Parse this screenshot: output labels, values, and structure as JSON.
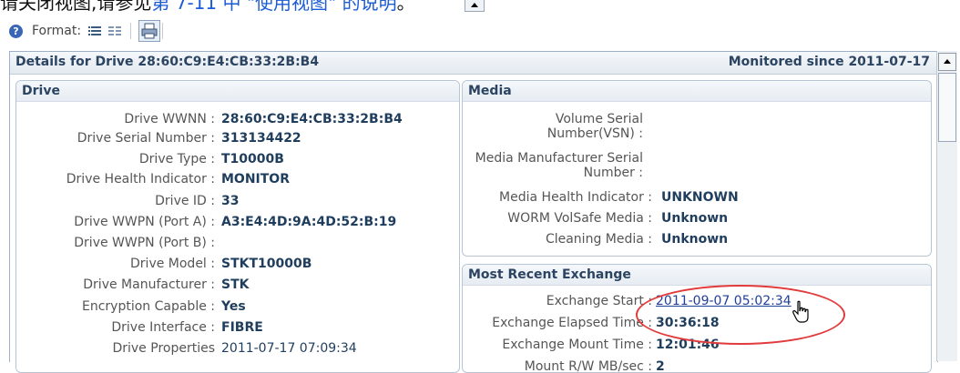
{
  "top_strip": {
    "text_prefix": "请关闭视图,请参见",
    "link_text": "第 7-11 中 \"使用视图\" 的说明",
    "text_suffix": "。"
  },
  "toolbar": {
    "help_icon": "?",
    "format_label": "Format:"
  },
  "panel": {
    "title": "Details for Drive 28:60:C9:E4:CB:33:2B:B4",
    "monitored": "Monitored since 2011-07-17"
  },
  "drive": {
    "header": "Drive",
    "rows": [
      {
        "label": "Drive WWNN :",
        "value": "28:60:C9:E4:CB:33:2B:B4"
      },
      {
        "label": "Drive Serial Number :",
        "value": "313134422"
      },
      {
        "label": "Drive Type :",
        "value": "T10000B"
      },
      {
        "label": "Drive Health Indicator :",
        "value": "MONITOR"
      },
      {
        "label": "Drive ID :",
        "value": "33"
      },
      {
        "label": "Drive WWPN (Port A) :",
        "value": "A3:E4:4D:9A:4D:52:B:19"
      },
      {
        "label": "Drive WWPN (Port B) :",
        "value": ""
      },
      {
        "label": "Drive Model :",
        "value": "STKT10000B"
      },
      {
        "label": "Drive Manufacturer :",
        "value": "STK"
      },
      {
        "label": "Encryption Capable :",
        "value": "Yes"
      },
      {
        "label": "Drive Interface :",
        "value": "FIBRE"
      },
      {
        "label": "Drive Properties",
        "value": "2011-07-17 07:09:34"
      }
    ]
  },
  "media": {
    "header": "Media",
    "rows": [
      {
        "label1": "Volume Serial",
        "label2": "Number(VSN) :",
        "value": ""
      },
      {
        "label1": "Media Manufacturer Serial",
        "label2": "Number :",
        "value": ""
      },
      {
        "label": "Media Health Indicator :",
        "value": "UNKNOWN"
      },
      {
        "label": "WORM VolSafe Media :",
        "value": "Unknown"
      },
      {
        "label": "Cleaning Media :",
        "value": "Unknown"
      }
    ]
  },
  "exchange": {
    "header": "Most Recent Exchange",
    "rows": [
      {
        "label": "Exchange Start :",
        "value": "2011-09-07 05:02:34"
      },
      {
        "label": "Exchange Elapsed Time :",
        "value": "30:36:18"
      },
      {
        "label": "Exchange Mount Time :",
        "value": "12:01:46"
      },
      {
        "label": "Mount R/W MB/sec :",
        "value": "2"
      }
    ]
  },
  "colors": {
    "annotation": "#e23b3b",
    "link": "#1f3f9a",
    "header_text": "#2b4461"
  }
}
